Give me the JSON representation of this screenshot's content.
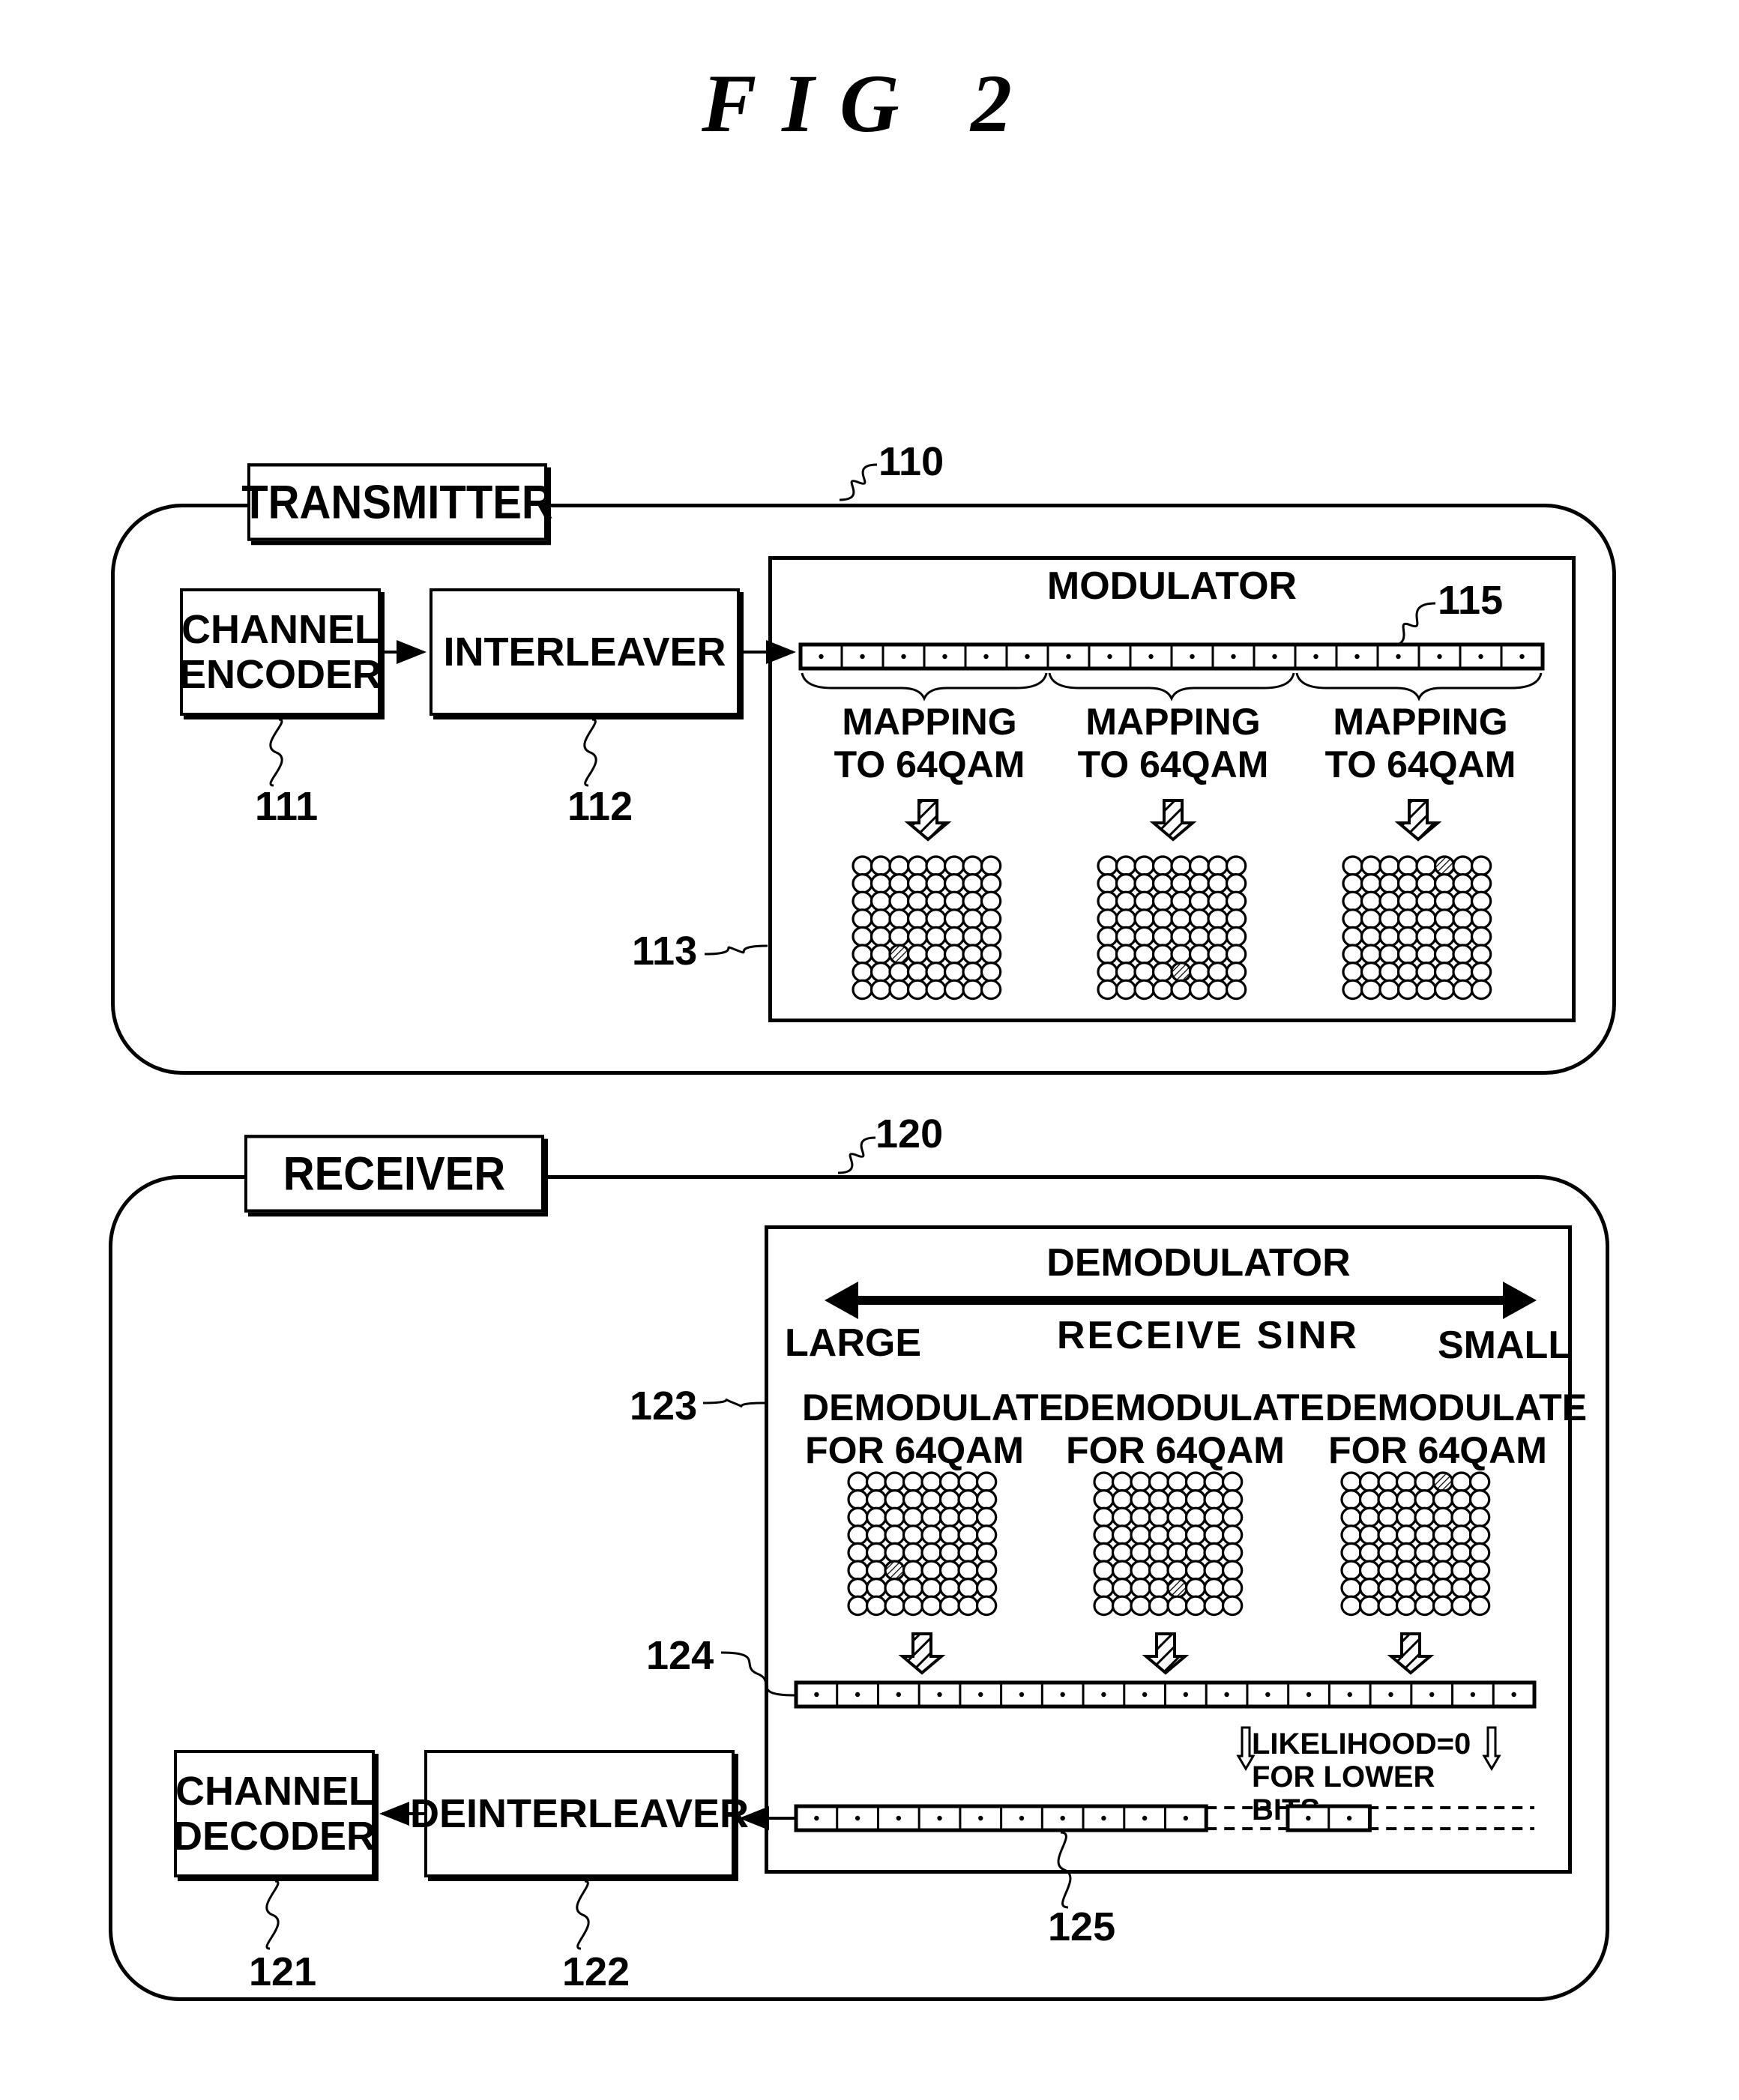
{
  "figure": {
    "title": "FIG 2"
  },
  "transmitter": {
    "label": "TRANSMITTER",
    "ref": "110",
    "channel_encoder": {
      "label": "CHANNEL\nENCODER",
      "ref": "111"
    },
    "interleaver": {
      "label": "INTERLEAVER",
      "ref": "112"
    },
    "modulator": {
      "label": "MODULATOR",
      "ref": "113",
      "bit_stream_ref": "115",
      "bit_cells": 18,
      "groups": [
        {
          "text": "MAPPING\nTO 64QAM",
          "highlight": {
            "row": 6,
            "col": 3
          }
        },
        {
          "text": "MAPPING\nTO 64QAM",
          "highlight": {
            "row": 7,
            "col": 5
          }
        },
        {
          "text": "MAPPING\nTO 64QAM",
          "highlight": {
            "row": 1,
            "col": 6
          }
        }
      ],
      "constellation": {
        "rows": 8,
        "cols": 8
      }
    }
  },
  "receiver": {
    "label": "RECEIVER",
    "ref": "120",
    "channel_decoder": {
      "label": "CHANNEL\nDECODER",
      "ref": "121"
    },
    "deinterleaver": {
      "label": "DEINTERLEAVER",
      "ref": "122"
    },
    "demodulator": {
      "label": "DEMODULATOR",
      "ref": "123",
      "sinr_axis": {
        "left": "LARGE",
        "center": "RECEIVE SINR",
        "right": "SMALL"
      },
      "groups": [
        {
          "text": "DEMODULATE\nFOR 64QAM",
          "highlight": {
            "row": 6,
            "col": 3
          }
        },
        {
          "text": "DEMODULATE\nFOR 64QAM",
          "highlight": {
            "row": 7,
            "col": 5
          }
        },
        {
          "text": "DEMODULATE\nFOR 64QAM",
          "highlight": {
            "row": 1,
            "col": 6
          }
        }
      ],
      "likelihood_stream_ref": "124",
      "likelihood_cells": 18,
      "output_stream_ref": "125",
      "output_cells_solid": 10,
      "output_cells_isolated": 2,
      "note": "LIKELIHOOD=0\nFOR LOWER BITS"
    }
  }
}
